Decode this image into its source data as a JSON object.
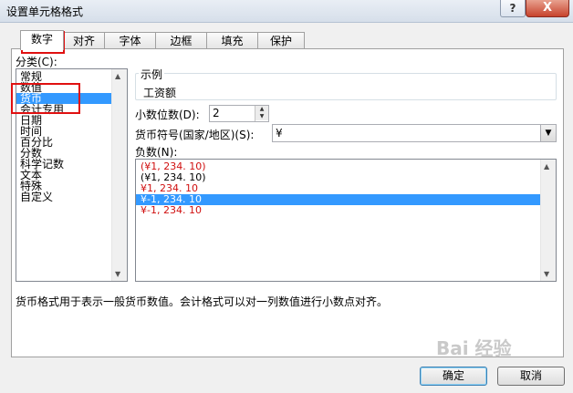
{
  "window": {
    "title": "设置单元格格式",
    "help_glyph": "?",
    "close_glyph": "X"
  },
  "tabs": [
    {
      "label": "数字",
      "active": true
    },
    {
      "label": "对齐"
    },
    {
      "label": "字体"
    },
    {
      "label": "边框"
    },
    {
      "label": "填充"
    },
    {
      "label": "保护"
    }
  ],
  "category_label": "分类(C):",
  "categories": [
    "常规",
    "数值",
    "货币",
    "会计专用",
    "日期",
    "时间",
    "百分比",
    "分数",
    "科学记数",
    "文本",
    "特殊",
    "自定义"
  ],
  "selected_category": "货币",
  "sample": {
    "label": "示例",
    "value": "工资额"
  },
  "decimal": {
    "label": "小数位数(D):",
    "value": "2"
  },
  "currency": {
    "label": "货币符号(国家/地区)(S):",
    "value": "¥"
  },
  "negative": {
    "label": "负数(N):",
    "items": [
      {
        "text": "(¥1, 234. 10)",
        "color": "#d01010"
      },
      {
        "text": "(¥1, 234. 10)",
        "color": "#000000"
      },
      {
        "text": "¥1, 234. 10",
        "color": "#d01010"
      },
      {
        "text": "¥-1, 234. 10",
        "color": "#ffffff",
        "selected": true
      },
      {
        "text": "¥-1, 234. 10",
        "color": "#d01010"
      }
    ]
  },
  "description": "货币格式用于表示一般货币数值。会计格式可以对一列数值进行小数点对齐。",
  "buttons": {
    "ok": "确定",
    "cancel": "取消"
  },
  "watermark": "Bai 经验",
  "colors": {
    "selection": "#3399ff",
    "highlight": "#e01010",
    "negative_red": "#d01010"
  }
}
